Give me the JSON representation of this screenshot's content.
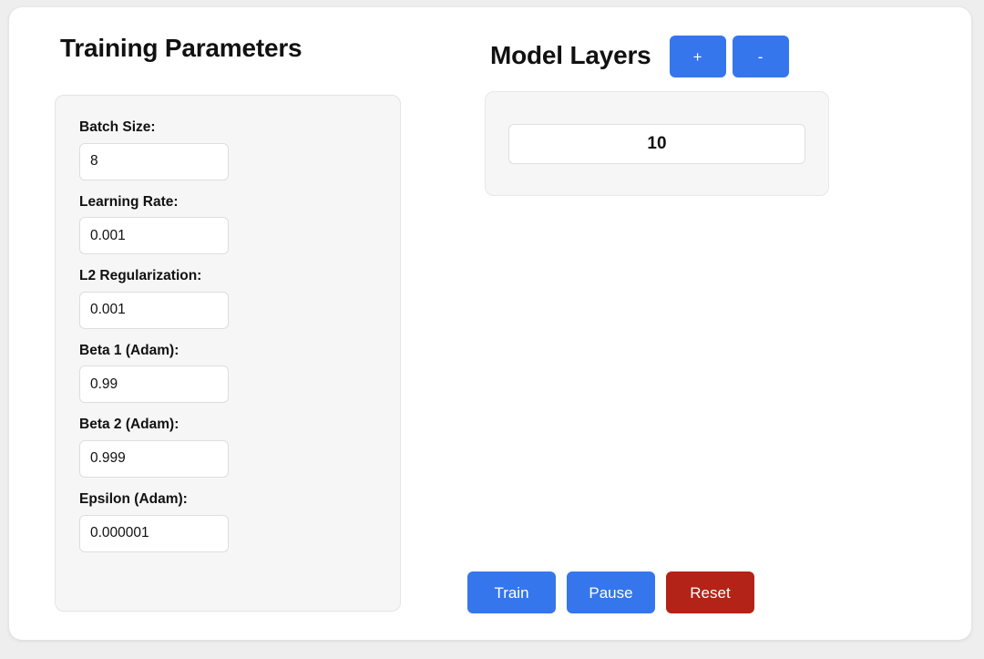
{
  "training": {
    "title": "Training Parameters",
    "fields": [
      {
        "label": "Batch Size:",
        "value": "8",
        "name": "batch-size"
      },
      {
        "label": "Learning Rate:",
        "value": "0.001",
        "name": "learning-rate"
      },
      {
        "label": "L2 Regularization:",
        "value": "0.001",
        "name": "l2-regularization"
      },
      {
        "label": "Beta 1 (Adam):",
        "value": "0.99",
        "name": "beta-1"
      },
      {
        "label": "Beta 2 (Adam):",
        "value": "0.999",
        "name": "beta-2"
      },
      {
        "label": "Epsilon (Adam):",
        "value": "0.000001",
        "name": "epsilon"
      }
    ]
  },
  "layers": {
    "title": "Model Layers",
    "add_label": "+",
    "remove_label": "-",
    "count": "10"
  },
  "actions": {
    "train_label": "Train",
    "pause_label": "Pause",
    "reset_label": "Reset"
  },
  "colors": {
    "primary_blue": "#3576ed",
    "danger_red": "#b32317",
    "panel_bg": "#f6f6f6",
    "page_bg": "#eeeeee",
    "card_bg": "#ffffff",
    "text": "#111111"
  }
}
